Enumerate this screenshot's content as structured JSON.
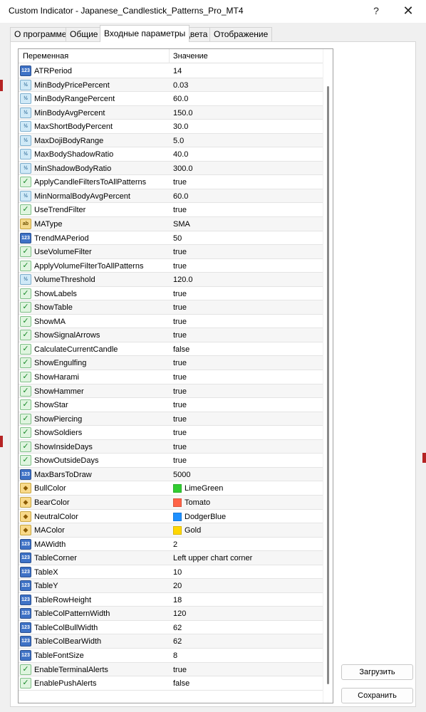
{
  "window": {
    "title": "Custom Indicator - Japanese_Candlestick_Patterns_Pro_MT4",
    "help_label": "?",
    "close_label": "✕"
  },
  "tabs": [
    {
      "label": "О программе",
      "active": false
    },
    {
      "label": "Общие",
      "active": false
    },
    {
      "label": "Входные параметры",
      "active": true
    },
    {
      "label": "Цвета",
      "active": false
    },
    {
      "label": "Отображение",
      "active": false
    }
  ],
  "grid": {
    "col_variable": "Переменная",
    "col_value": "Значение",
    "rows": [
      {
        "name": "ATRPeriod",
        "value": "14",
        "type": "int"
      },
      {
        "name": "MinBodyPricePercent",
        "value": "0.03",
        "type": "double"
      },
      {
        "name": "MinBodyRangePercent",
        "value": "60.0",
        "type": "double"
      },
      {
        "name": "MinBodyAvgPercent",
        "value": "150.0",
        "type": "double"
      },
      {
        "name": "MaxShortBodyPercent",
        "value": "30.0",
        "type": "double"
      },
      {
        "name": "MaxDojiBodyRange",
        "value": "5.0",
        "type": "double"
      },
      {
        "name": "MaxBodyShadowRatio",
        "value": "40.0",
        "type": "double"
      },
      {
        "name": "MinShadowBodyRatio",
        "value": "300.0",
        "type": "double"
      },
      {
        "name": "ApplyCandleFiltersToAllPatterns",
        "value": "true",
        "type": "bool"
      },
      {
        "name": "MinNormalBodyAvgPercent",
        "value": "60.0",
        "type": "double"
      },
      {
        "name": "UseTrendFilter",
        "value": "true",
        "type": "bool"
      },
      {
        "name": "MAType",
        "value": "SMA",
        "type": "string"
      },
      {
        "name": "TrendMAPeriod",
        "value": "50",
        "type": "int"
      },
      {
        "name": "UseVolumeFilter",
        "value": "true",
        "type": "bool"
      },
      {
        "name": "ApplyVolumeFilterToAllPatterns",
        "value": "true",
        "type": "bool"
      },
      {
        "name": "VolumeThreshold",
        "value": "120.0",
        "type": "double"
      },
      {
        "name": "ShowLabels",
        "value": "true",
        "type": "bool"
      },
      {
        "name": "ShowTable",
        "value": "true",
        "type": "bool"
      },
      {
        "name": "ShowMA",
        "value": "true",
        "type": "bool"
      },
      {
        "name": "ShowSignalArrows",
        "value": "true",
        "type": "bool"
      },
      {
        "name": "CalculateCurrentCandle",
        "value": "false",
        "type": "bool"
      },
      {
        "name": "ShowEngulfing",
        "value": "true",
        "type": "bool"
      },
      {
        "name": "ShowHarami",
        "value": "true",
        "type": "bool"
      },
      {
        "name": "ShowHammer",
        "value": "true",
        "type": "bool"
      },
      {
        "name": "ShowStar",
        "value": "true",
        "type": "bool"
      },
      {
        "name": "ShowPiercing",
        "value": "true",
        "type": "bool"
      },
      {
        "name": "ShowSoldiers",
        "value": "true",
        "type": "bool"
      },
      {
        "name": "ShowInsideDays",
        "value": "true",
        "type": "bool"
      },
      {
        "name": "ShowOutsideDays",
        "value": "true",
        "type": "bool"
      },
      {
        "name": "MaxBarsToDraw",
        "value": "5000",
        "type": "int"
      },
      {
        "name": "BullColor",
        "value": "LimeGreen",
        "type": "color",
        "swatch": "#32cd32"
      },
      {
        "name": "BearColor",
        "value": "Tomato",
        "type": "color",
        "swatch": "#ff6347"
      },
      {
        "name": "NeutralColor",
        "value": "DodgerBlue",
        "type": "color",
        "swatch": "#1e90ff"
      },
      {
        "name": "MAColor",
        "value": "Gold",
        "type": "color",
        "swatch": "#ffd700"
      },
      {
        "name": "MAWidth",
        "value": "2",
        "type": "int"
      },
      {
        "name": "TableCorner",
        "value": "Left upper chart corner",
        "type": "int"
      },
      {
        "name": "TableX",
        "value": "10",
        "type": "int"
      },
      {
        "name": "TableY",
        "value": "20",
        "type": "int"
      },
      {
        "name": "TableRowHeight",
        "value": "18",
        "type": "int"
      },
      {
        "name": "TableColPatternWidth",
        "value": "120",
        "type": "int"
      },
      {
        "name": "TableColBullWidth",
        "value": "62",
        "type": "int"
      },
      {
        "name": "TableColBearWidth",
        "value": "62",
        "type": "int"
      },
      {
        "name": "TableFontSize",
        "value": "8",
        "type": "int"
      },
      {
        "name": "EnableTerminalAlerts",
        "value": "true",
        "type": "bool"
      },
      {
        "name": "EnablePushAlerts",
        "value": "false",
        "type": "bool"
      }
    ]
  },
  "icons": {
    "int": "123",
    "double": "½",
    "bool": "✓",
    "string": "ab",
    "color": "◆"
  },
  "buttons": {
    "load_label": "Загрузить",
    "save_label": "Сохранить"
  }
}
